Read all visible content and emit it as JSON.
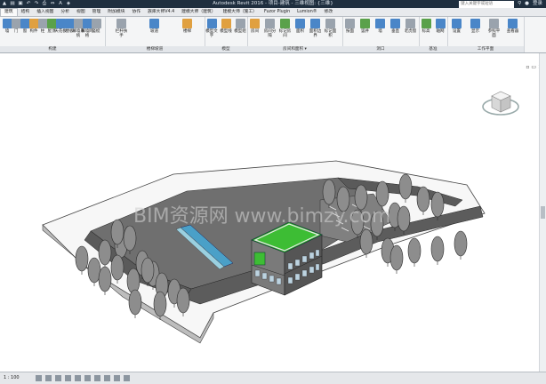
{
  "window": {
    "title": "Autodesk Revit 2016 -   项目-建筑 - 三维视图: {三维}",
    "search_placeholder": "键入关键字或短语",
    "user": "登录"
  },
  "tabs": [
    "建筑",
    "结构",
    "插入视图",
    "分析",
    "视图",
    "管理",
    "附加模块",
    "协作",
    "族库大师V4.4",
    "建模大师（建筑）",
    "建模大师（施工）",
    "Fuzor Plugin",
    "Lumion®",
    "修改"
  ],
  "ribbon": {
    "groups": [
      {
        "label": "构建",
        "buttons": [
          "墙",
          "门",
          "窗",
          "构件",
          "柱",
          "屋顶",
          "天花板",
          "楼板",
          "幕墙系统",
          "幕墙网格",
          "竖梃"
        ]
      },
      {
        "label": "楼梯坡道",
        "buttons": [
          "栏杆扶手",
          "坡道",
          "楼梯"
        ]
      },
      {
        "label": "模型",
        "buttons": [
          "模型文字",
          "模型线",
          "模型组"
        ]
      },
      {
        "label": "房间和面积 ▾",
        "buttons": [
          "房间",
          "房间分隔",
          "标记房间",
          "面积",
          "面积边界",
          "标记面积"
        ]
      },
      {
        "label": "洞口",
        "buttons": [
          "按面",
          "竖井",
          "墙",
          "垂直",
          "老虎窗"
        ]
      },
      {
        "label": "基准",
        "buttons": [
          "标高",
          "轴网"
        ]
      },
      {
        "label": "工作平面",
        "buttons": [
          "设置",
          "显示",
          "参照平面",
          "查看器"
        ]
      }
    ]
  },
  "viewport": {
    "watermark": "BIM资源网  www.bimzy.com",
    "view_controls": "▫ ▭ ✕"
  },
  "statusbar": {
    "scale": "1 : 100"
  },
  "colors": {
    "roof": "#3dbd34",
    "ribbon": "#f4f5f6",
    "titlebar": "#1f2f3f"
  }
}
